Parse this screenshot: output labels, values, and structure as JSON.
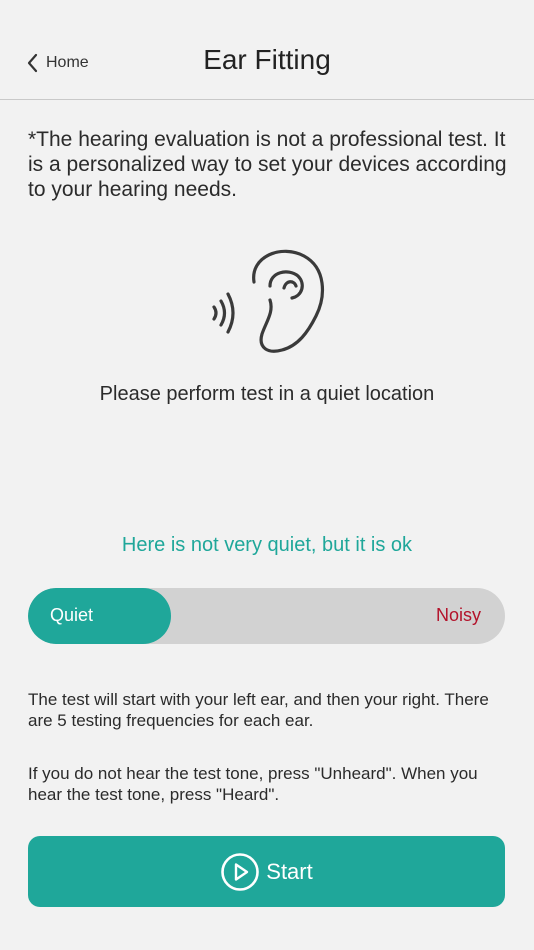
{
  "header": {
    "back_label": "Home",
    "title": "Ear Fitting"
  },
  "disclaimer": "*The hearing evaluation is not a professional test. It is a personalized way to set your devices according to your hearing needs.",
  "illustration_icon": "ear-with-sound-waves-icon",
  "quiet_instruction": "Please perform test in a quiet location",
  "noise_status": "Here is not very quiet, but it is ok",
  "noise_meter": {
    "left_label": "Quiet",
    "right_label": "Noisy",
    "level": 0.3
  },
  "info": {
    "line1": "The test will start with your left ear, and then your right. There are 5 testing frequencies for each ear.",
    "line2": "If you do not hear the test tone, press \"Unheard\". When you hear the test tone, press \"Heard\"."
  },
  "start_button": {
    "label": "Start",
    "icon": "play-circle-icon"
  },
  "colors": {
    "accent": "#1fa79a",
    "noisy": "#b3122a",
    "background": "#f2f2f2",
    "meter_track": "#d2d2d2"
  }
}
